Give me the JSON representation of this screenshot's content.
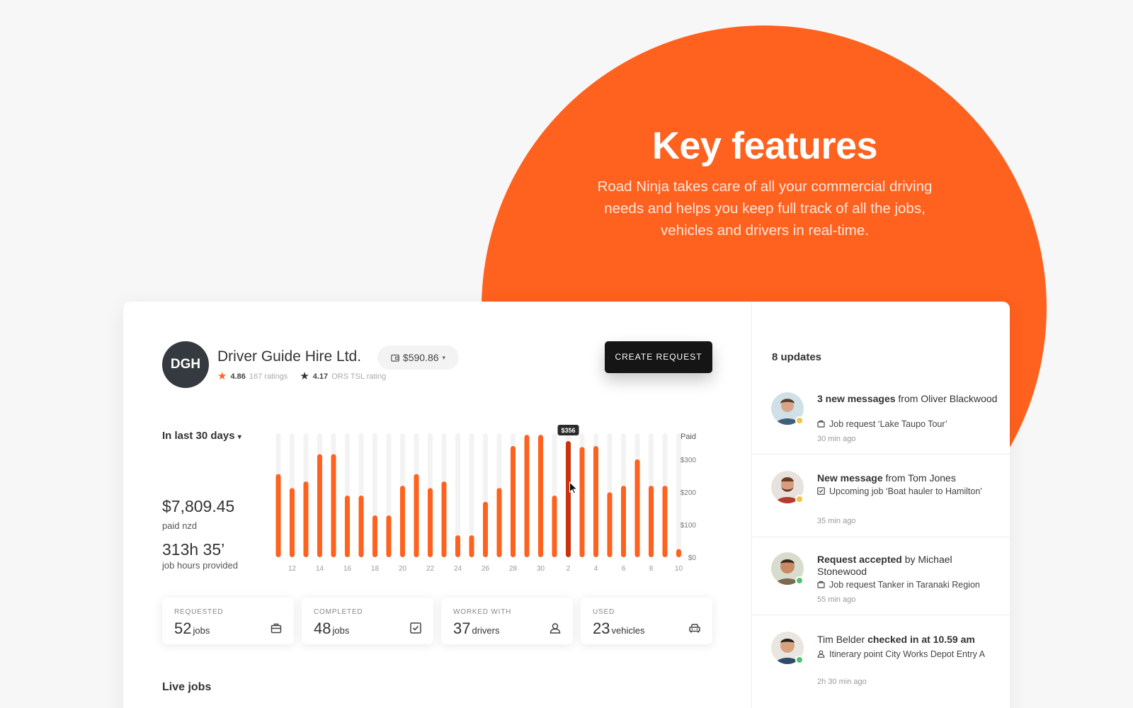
{
  "hero": {
    "title": "Key features",
    "subtitle": "Road Ninja takes care of all your commercial driving needs and helps you keep full track of all the jobs, vehicles and drivers in real-time."
  },
  "company": {
    "initials": "DGH",
    "name": "Driver Guide Hire Ltd.",
    "balance": "$590.86",
    "rating_value": "4.86",
    "rating_count": "167 ratings",
    "ors_value": "4.17",
    "ors_label": "ORS TSL rating"
  },
  "create_button": "CREATE REQUEST",
  "summary": {
    "period": "In last 30 days",
    "paid_amount": "$7,809.45",
    "paid_label": "paid nzd",
    "hours": "313h 35’",
    "hours_label": "job hours provided"
  },
  "chart_data": {
    "type": "bar",
    "categories": [
      "11",
      "12",
      "13",
      "14",
      "15",
      "16",
      "17",
      "18",
      "19",
      "20",
      "21",
      "22",
      "23",
      "24",
      "25",
      "26",
      "27",
      "28",
      "29",
      "30",
      "1",
      "2",
      "3",
      "4",
      "5",
      "6",
      "7",
      "8",
      "9",
      "10"
    ],
    "values": [
      255,
      212,
      232,
      316,
      316,
      189,
      189,
      128,
      128,
      219,
      255,
      212,
      232,
      67,
      67,
      170,
      212,
      341,
      375,
      375,
      189,
      356,
      338,
      341,
      199,
      219,
      300,
      219,
      219,
      25
    ],
    "x_tick_labels": [
      "12",
      "14",
      "16",
      "18",
      "20",
      "22",
      "24",
      "26",
      "28",
      "30",
      "2",
      "4",
      "6",
      "8",
      "10"
    ],
    "y_tick_labels": [
      "$0",
      "$100",
      "$200",
      "$300"
    ],
    "ylabel": "Paid",
    "ylim": [
      0,
      380
    ],
    "highlight_index": 21,
    "highlight_label": "$356",
    "colors": {
      "bar": "#ff611e",
      "highlight": "#c8320d",
      "track": "#f3f3f3"
    }
  },
  "stats": [
    {
      "label": "REQUESTED",
      "value": "52",
      "unit": "jobs",
      "icon": "briefcase-icon"
    },
    {
      "label": "COMPLETED",
      "value": "48",
      "unit": "jobs",
      "icon": "check-square-icon"
    },
    {
      "label": "WORKED WITH",
      "value": "37",
      "unit": "drivers",
      "icon": "user-icon"
    },
    {
      "label": "USED",
      "value": "23",
      "unit": "vehicles",
      "icon": "car-icon"
    }
  ],
  "live_jobs_title": "Live jobs",
  "updates": {
    "title": "8 updates",
    "items": [
      {
        "bold": "3 new messages",
        "rest": " from Oliver Blackwood",
        "detail": "Job request ‘Lake Taupo Tour’",
        "time": "30 min ago",
        "status_color": "#f4c23e",
        "icon": "briefcase-icon"
      },
      {
        "bold": "New message",
        "rest": " from Tom Jones",
        "detail": "Upcoming job ‘Boat hauler to Hamilton’",
        "time": "35 min ago",
        "status_color": "#f4c23e",
        "icon": "check-square-icon"
      },
      {
        "bold": "Request accepted",
        "rest": " by Michael Stonewood",
        "detail": "Job request  Tanker in Taranaki Region",
        "time": "55 min ago",
        "status_color": "#4cc46a",
        "icon": "briefcase-icon"
      },
      {
        "pre": "Tim Belder ",
        "bold": "checked in at 10.59 am",
        "detail": "Itinerary point  City Works Depot Entry A",
        "time": "2h 30 min ago",
        "status_color": "#4cc46a",
        "icon": "user-icon"
      }
    ]
  }
}
